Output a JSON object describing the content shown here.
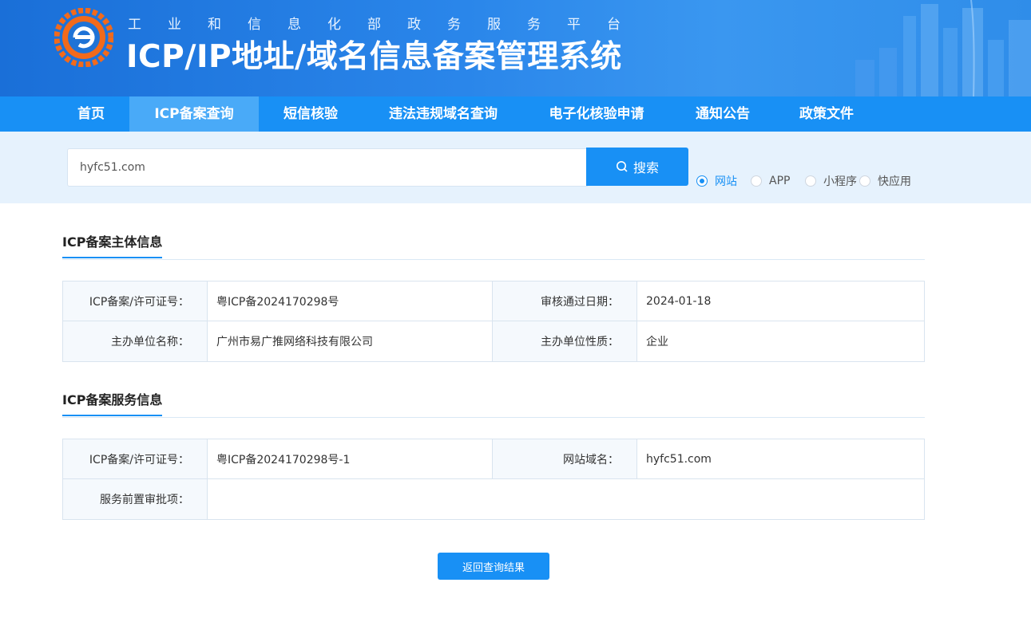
{
  "header": {
    "subtitle": "工业和信息化部政务服务平台",
    "title": "ICP/IP地址/域名信息备案管理系统"
  },
  "nav": {
    "items": [
      {
        "label": "首页",
        "active": false
      },
      {
        "label": "ICP备案查询",
        "active": true
      },
      {
        "label": "短信核验",
        "active": false
      },
      {
        "label": "违法违规域名查询",
        "active": false
      },
      {
        "label": "电子化核验申请",
        "active": false
      },
      {
        "label": "通知公告",
        "active": false
      },
      {
        "label": "政策文件",
        "active": false
      }
    ]
  },
  "search": {
    "value": "hyfc51.com",
    "button_label": "搜索",
    "options": [
      {
        "label": "网站",
        "checked": true
      },
      {
        "label": "APP",
        "checked": false
      },
      {
        "label": "小程序",
        "checked": false
      },
      {
        "label": "快应用",
        "checked": false
      }
    ]
  },
  "subject_info": {
    "title": "ICP备案主体信息",
    "rows": [
      {
        "label1": "ICP备案/许可证号：",
        "value1": "粤ICP备2024170298号",
        "label2": "审核通过日期：",
        "value2": "2024-01-18"
      },
      {
        "label1": "主办单位名称：",
        "value1": "广州市易广推网络科技有限公司",
        "label2": "主办单位性质：",
        "value2": "企业"
      }
    ]
  },
  "service_info": {
    "title": "ICP备案服务信息",
    "row1": {
      "label1": "ICP备案/许可证号：",
      "value1": "粤ICP备2024170298号-1",
      "label2": "网站域名：",
      "value2": "hyfc51.com"
    },
    "row2": {
      "label": "服务前置审批项：",
      "value": ""
    }
  },
  "back_button_label": "返回查询结果",
  "colors": {
    "primary": "#1890f5",
    "nav_active": "#49aaf8",
    "search_band": "#e6f2fd",
    "label_bg": "#f5f9fd"
  }
}
